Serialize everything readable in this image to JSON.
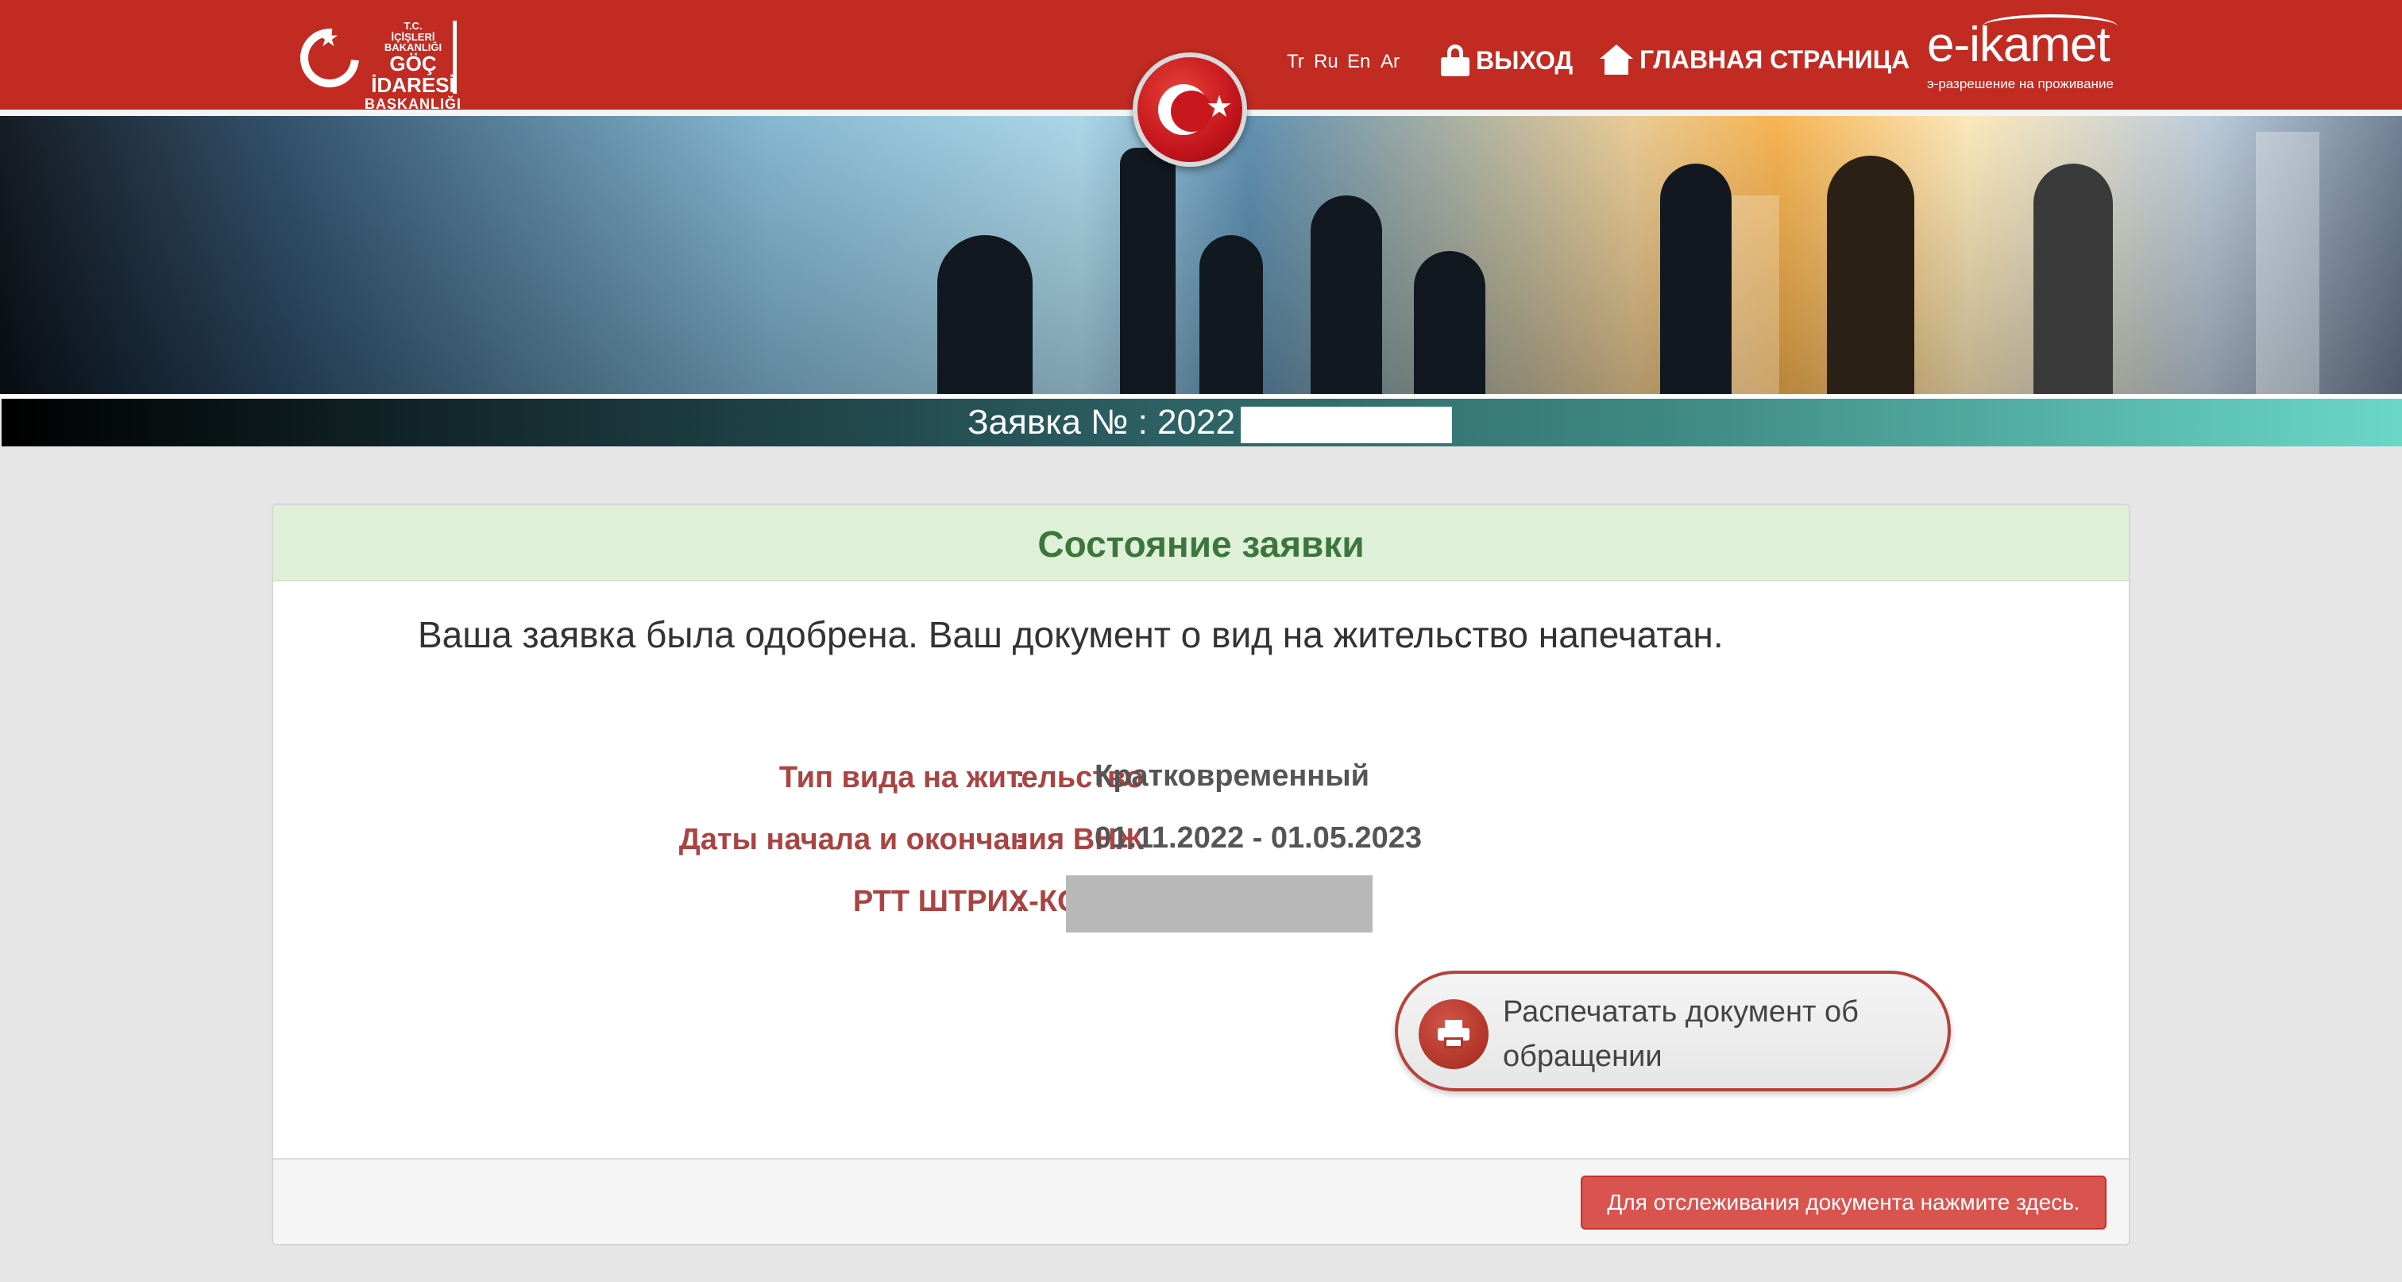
{
  "header": {
    "ministry_logo": {
      "line1": "T.C.",
      "line2": "İÇİŞLERİ BAKANLIĞI",
      "line3": "GÖÇ İDARESİ",
      "line4": "BAŞKANLIĞI"
    },
    "languages": [
      "Tr",
      "Ru",
      "En",
      "Ar"
    ],
    "logout_label": "ВЫХОД",
    "home_label": "ГЛАВНАЯ СТРАНИЦА",
    "eikamet": {
      "brand": "e-ikamet",
      "subtitle": "э-разрешение на проживание"
    },
    "colors": {
      "primary_red": "#c12b22"
    }
  },
  "application": {
    "number_label": "Заявка № : 2022"
  },
  "status_panel": {
    "title": "Состояние заявки",
    "message": "Ваша заявка была одобрена. Ваш документ о вид на жительство напечатан.",
    "rows": [
      {
        "label": "Тип вида на жительство",
        "separator": ":",
        "value": "Кратковременный"
      },
      {
        "label": "Даты начала и окончания ВНЖ",
        "separator": ":",
        "value": "01.11.2022 - 01.05.2023"
      },
      {
        "label": "РТТ ШТРИХ-КОД №",
        "separator": ":",
        "value": ""
      }
    ],
    "print_button_label": "Распечатать документ об обращении",
    "track_button_label": "Для отслеживания документа нажмите здесь.",
    "colors": {
      "title_green": "#3c763d",
      "label_red": "#a94442",
      "button_red": "#d9534f"
    }
  }
}
